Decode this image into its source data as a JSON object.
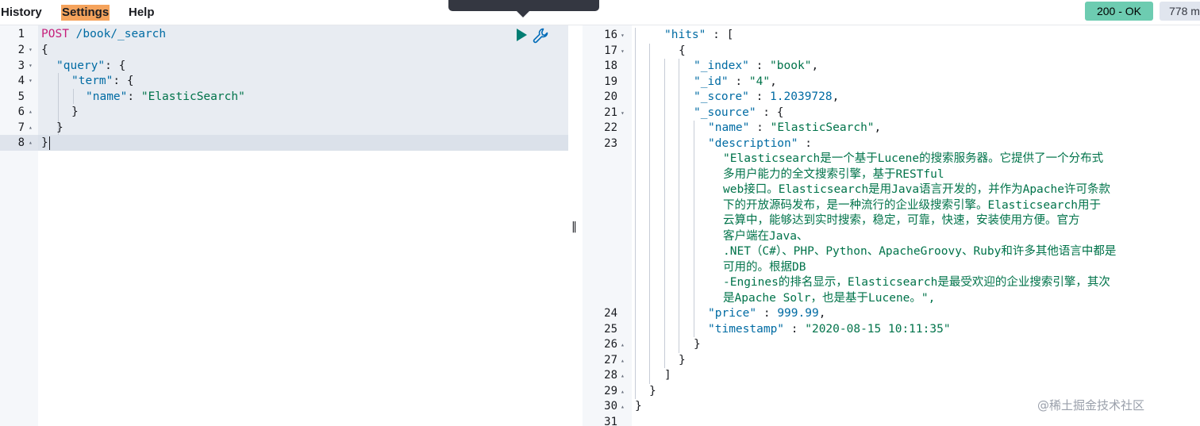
{
  "menu": {
    "history": "History",
    "settings": "Settings",
    "help": "Help"
  },
  "status": {
    "code": "200 - OK",
    "time": "778 ms"
  },
  "request": {
    "lines": [
      {
        "num": "1",
        "fold": ""
      },
      {
        "num": "2",
        "fold": "▾"
      },
      {
        "num": "3",
        "fold": "▾"
      },
      {
        "num": "4",
        "fold": "▾"
      },
      {
        "num": "5",
        "fold": ""
      },
      {
        "num": "6",
        "fold": "▴"
      },
      {
        "num": "7",
        "fold": "▴"
      },
      {
        "num": "8",
        "fold": "▴"
      }
    ],
    "method": "POST",
    "path": "/book/_search",
    "open_brace": "{",
    "query_key": "\"query\"",
    "term_key": "\"term\"",
    "name_key": "\"name\"",
    "name_value": "\"ElasticSearch\"",
    "close_brace": "}"
  },
  "response": {
    "line_numbers": [
      "16",
      "17",
      "18",
      "19",
      "20",
      "21",
      "22",
      "23",
      "24",
      "25",
      "26",
      "27",
      "28",
      "29",
      "30",
      "31"
    ],
    "folds": {
      "16": "▾",
      "17": "▾",
      "21": "▾",
      "26": "▴",
      "27": "▴",
      "28": "▴",
      "29": "▴",
      "30": "▴"
    },
    "hits_key": "\"hits\"",
    "index_key": "\"_index\"",
    "index_value": "\"book\"",
    "id_key": "\"_id\"",
    "id_value": "\"4\"",
    "score_key": "\"_score\"",
    "score_value": "1.2039728",
    "source_key": "\"_source\"",
    "name_key": "\"name\"",
    "name_value": "\"ElasticSearch\"",
    "description_key": "\"description\"",
    "description_lines": [
      "\"Elasticsearch是一个基于Lucene的搜索服务器。它提供了一个分布式",
      "多用户能力的全文搜索引擎，基于RESTful",
      "web接口。Elasticsearch是用Java语言开发的，并作为Apache许可条款",
      "下的开放源码发布，是一种流行的企业级搜索引擎。Elasticsearch用于",
      "云算中，能够达到实时搜索，稳定，可靠，快速，安装使用方便。官方",
      "客户端在Java、",
      ".NET（C#）、PHP、Python、ApacheGroovy、Ruby和许多其他语言中都是",
      "可用的。根据DB",
      "-Engines的排名显示，Elasticsearch是最受欢迎的企业搜索引擎，其次",
      "是Apache Solr，也是基于Lucene。\","
    ],
    "price_key": "\"price\"",
    "price_value": "999.99",
    "timestamp_key": "\"timestamp\"",
    "timestamp_value": "\"2020-08-15 10:11:35\""
  },
  "watermark": "@稀土掘金技术社区"
}
